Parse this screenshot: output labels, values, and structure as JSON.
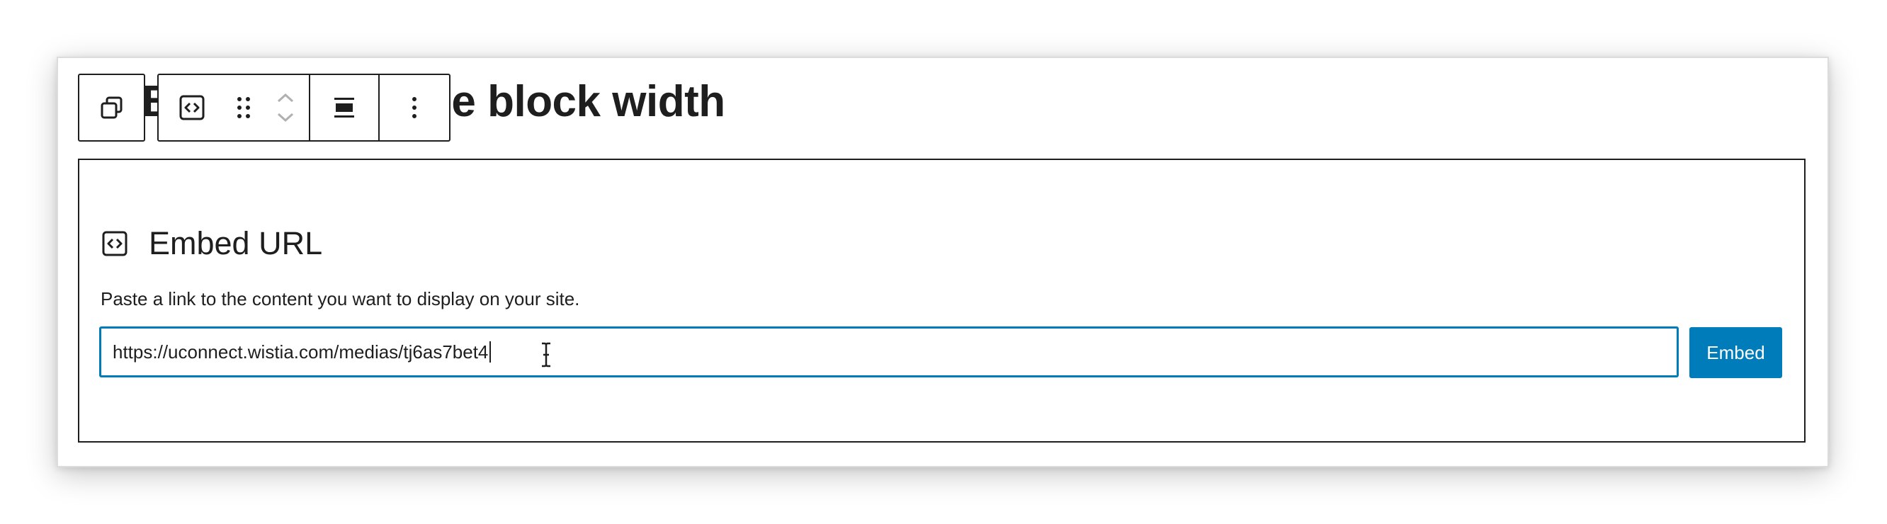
{
  "heading": {
    "title": "Use the Embed Block to change block width",
    "visible_title": "Block to change block width"
  },
  "toolbar": {
    "parent_selector_icon": "block-parent-icon",
    "block_type_icon": "embed-code-icon",
    "drag_handle_icon": "drag-handle-icon",
    "move_up_icon": "chevron-up-icon",
    "move_down_icon": "chevron-down-icon",
    "align_icon": "align-wide-icon",
    "options_icon": "more-vertical-icon"
  },
  "embed": {
    "icon": "embed-code-icon",
    "label": "Embed URL",
    "instructions": "Paste a link to the content you want to display on your site.",
    "url_value": "https://uconnect.wistia.com/medias/tj6as7bet4",
    "button_label": "Embed"
  },
  "colors": {
    "accent": "#007cba",
    "text": "#1e1e1e",
    "border": "#1e1e1e"
  }
}
